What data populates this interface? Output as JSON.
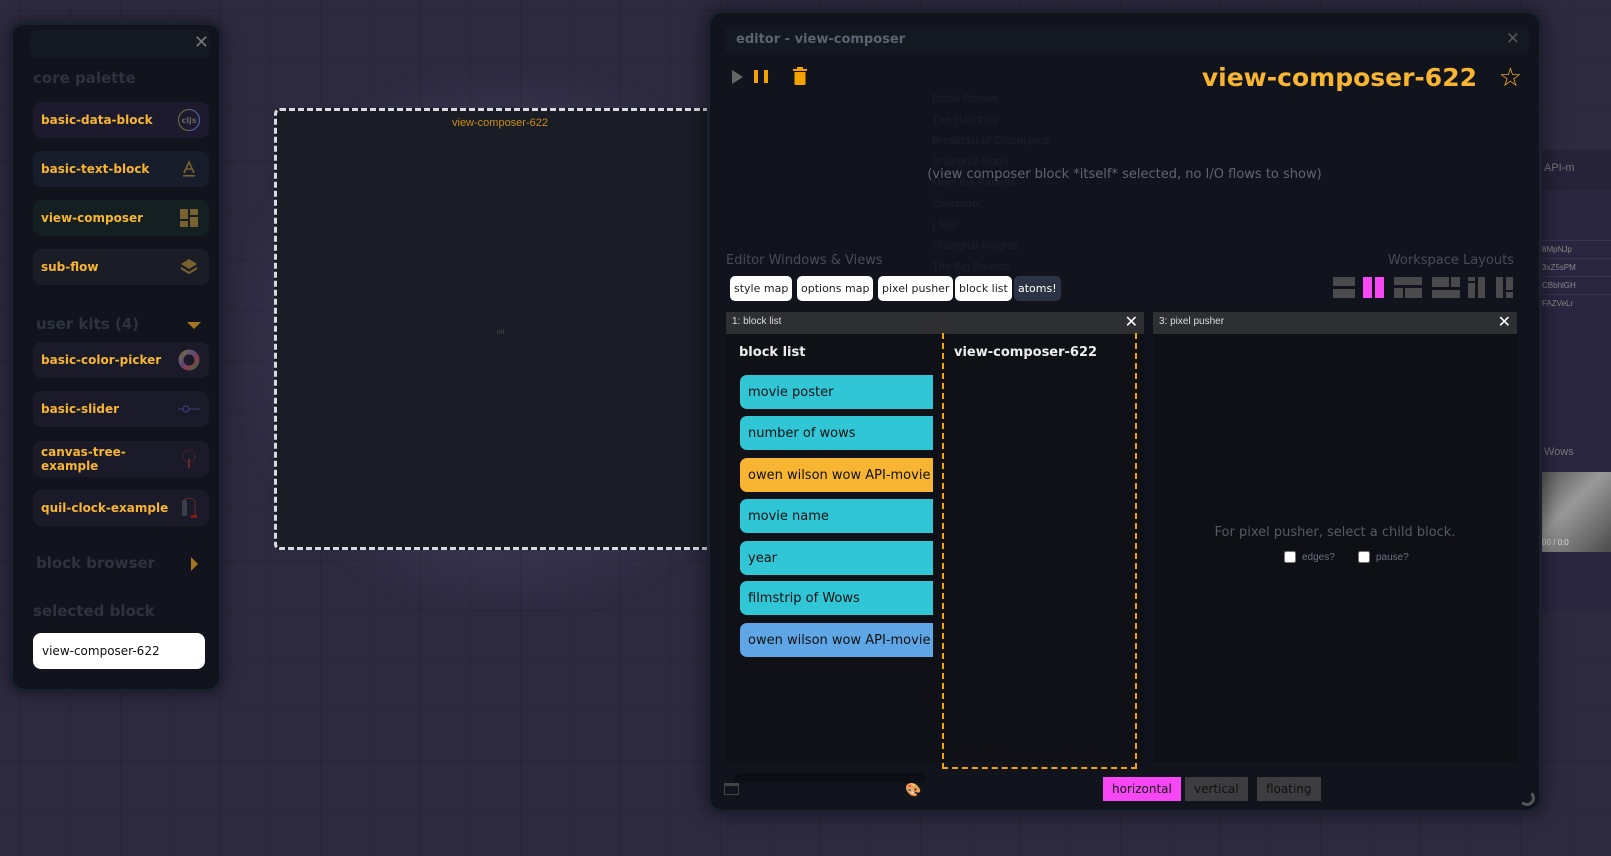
{
  "palette": {
    "sections": {
      "core": "core palette",
      "user_kits": "user kits (4)",
      "block_browser": "block browser",
      "selected": "selected block"
    },
    "core_items": [
      {
        "label": "basic-data-block",
        "icon": "cljs-icon",
        "bg": "#1c1a2c"
      },
      {
        "label": "basic-text-block",
        "icon": "text-a-icon",
        "bg": "#171d2b"
      },
      {
        "label": "view-composer",
        "icon": "grid-layout-icon",
        "bg": "#141f22"
      },
      {
        "label": "sub-flow",
        "icon": "layers-icon",
        "bg": "#1a1d26"
      }
    ],
    "user_kit_items": [
      {
        "label": "basic-color-picker",
        "icon": "color-wheel-icon"
      },
      {
        "label": "basic-slider",
        "icon": "slider-icon"
      },
      {
        "label": "canvas-tree-example",
        "icon": "tree-icon"
      },
      {
        "label": "quil-clock-example",
        "icon": "clock-figure-icon"
      }
    ],
    "selected_block_value": "view-composer-622"
  },
  "canvas": {
    "block_title": "view-composer-622",
    "block_placeholder": "nil"
  },
  "editor": {
    "window_title": "editor - view-composer",
    "block_title": "view-composer-622",
    "io_message": "(view composer block *itself* selected, no I/O flows to show)",
    "ghost_titles": [
      "Bottle Rocket",
      "The Haunting",
      "Breakfast of Champions",
      "Shanghai Noon",
      "Meet the Parents",
      "Zoolander",
      "I Spy",
      "Shanghai Knights",
      "The Big Bounce"
    ],
    "windows_label": "Editor Windows & Views",
    "layouts_label": "Workspace Layouts",
    "view_buttons": [
      "style map",
      "options map",
      "pixel pusher",
      "block list",
      "atoms!"
    ],
    "layouts": [
      {
        "name": "stacked-rows",
        "active": false
      },
      {
        "name": "two-columns",
        "active": true
      },
      {
        "name": "top-bottom-split",
        "active": false
      },
      {
        "name": "top-split-bottom",
        "active": false
      },
      {
        "name": "left-split-columns",
        "active": false
      },
      {
        "name": "right-split-columns",
        "active": false
      }
    ],
    "accent_magenta": "#f746f4",
    "pane1": {
      "header": "1: block list",
      "heading": "block list",
      "items": [
        {
          "label": "movie poster",
          "color": "#31c6d6"
        },
        {
          "label": "number of wows",
          "color": "#31c6d6"
        },
        {
          "label": "owen wilson wow API-movie list",
          "color": "#f7b531"
        },
        {
          "label": "movie name",
          "color": "#31c6d6"
        },
        {
          "label": "year",
          "color": "#31c6d6"
        },
        {
          "label": "filmstrip of Wows",
          "color": "#31c6d6"
        },
        {
          "label": "owen wilson wow API-movie lookup",
          "color": "#5ea6e6"
        }
      ],
      "composer_title": "view-composer-622"
    },
    "pane3": {
      "header": "3: pixel pusher",
      "message": "For pixel pusher, select a child block.",
      "checkbox_edges": "edges?",
      "checkbox_pause": "pause?"
    },
    "orientation": {
      "options": [
        "horizontal",
        "vertical",
        "floating"
      ],
      "selected": "horizontal"
    }
  },
  "ghost_right": {
    "header": "API-m",
    "rows": [
      "8MpNJp",
      "3xZ5sPM",
      "CBbhlGH",
      "FAZVeLr"
    ],
    "label2": "Wows",
    "time": "00 / 0:0"
  }
}
